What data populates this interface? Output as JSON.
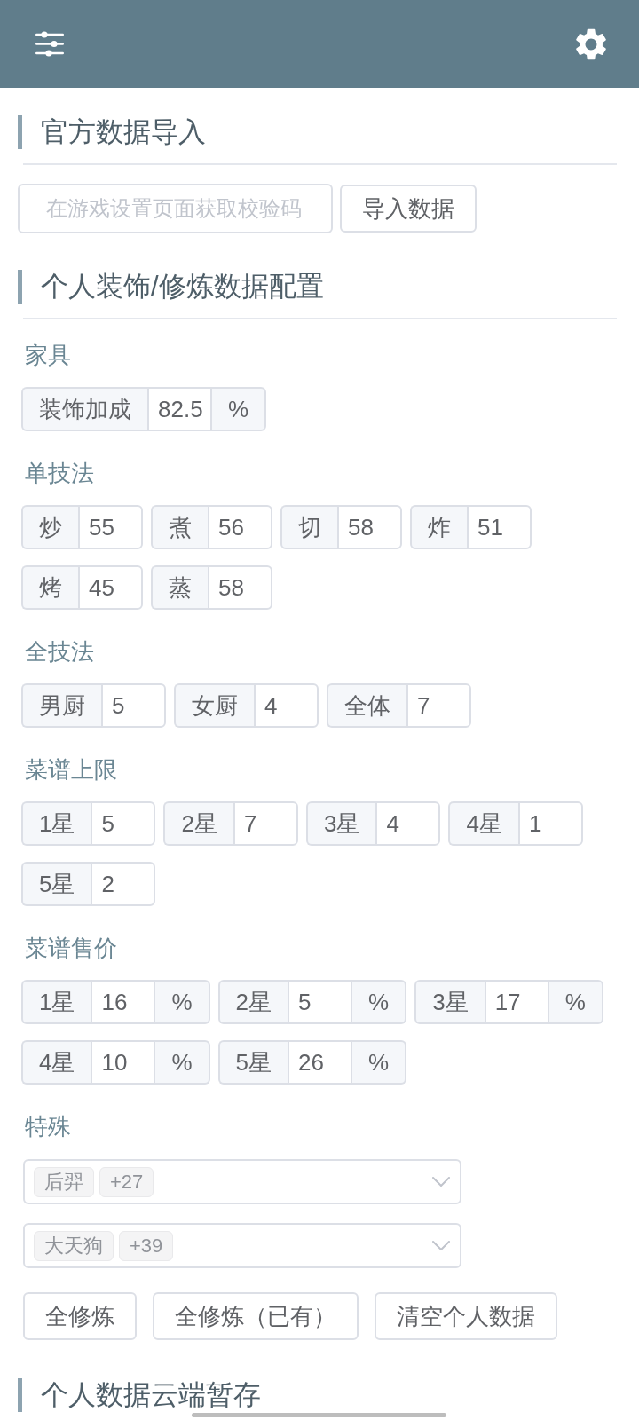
{
  "import_section": {
    "title": "官方数据导入",
    "code_field": {
      "placeholder": "在游戏设置页面获取校验码"
    },
    "import_button": "导入数据"
  },
  "config_section": {
    "title": "个人装饰/修炼数据配置",
    "groups": [
      {
        "label": "家具",
        "fields": [
          {
            "label": "装饰加成",
            "value": "82.5",
            "unit": "%"
          }
        ]
      },
      {
        "label": "单技法",
        "fields": [
          {
            "label": "炒",
            "value": "55"
          },
          {
            "label": "煮",
            "value": "56"
          },
          {
            "label": "切",
            "value": "58"
          },
          {
            "label": "炸",
            "value": "51"
          },
          {
            "label": "烤",
            "value": "45"
          },
          {
            "label": "蒸",
            "value": "58"
          }
        ]
      },
      {
        "label": "全技法",
        "fields": [
          {
            "label": "男厨",
            "value": "5"
          },
          {
            "label": "女厨",
            "value": "4"
          },
          {
            "label": "全体",
            "value": "7"
          }
        ]
      },
      {
        "label": "菜谱上限",
        "fields": [
          {
            "label": "1星",
            "value": "5"
          },
          {
            "label": "2星",
            "value": "7"
          },
          {
            "label": "3星",
            "value": "4"
          },
          {
            "label": "4星",
            "value": "1"
          },
          {
            "label": "5星",
            "value": "2"
          }
        ]
      },
      {
        "label": "菜谱售价",
        "fields": [
          {
            "label": "1星",
            "value": "16",
            "unit": "%"
          },
          {
            "label": "2星",
            "value": "5",
            "unit": "%"
          },
          {
            "label": "3星",
            "value": "17",
            "unit": "%"
          },
          {
            "label": "4星",
            "value": "10",
            "unit": "%"
          },
          {
            "label": "5星",
            "value": "26",
            "unit": "%"
          }
        ]
      }
    ],
    "special": {
      "label": "特殊",
      "selects": [
        {
          "tags": [
            "后羿",
            "+27"
          ]
        },
        {
          "tags": [
            "大天狗",
            "+39"
          ]
        }
      ]
    },
    "buttons": [
      "全修炼",
      "全修炼（已有）",
      "清空个人数据"
    ]
  },
  "cloud_section": {
    "title": "个人数据云端暂存"
  }
}
